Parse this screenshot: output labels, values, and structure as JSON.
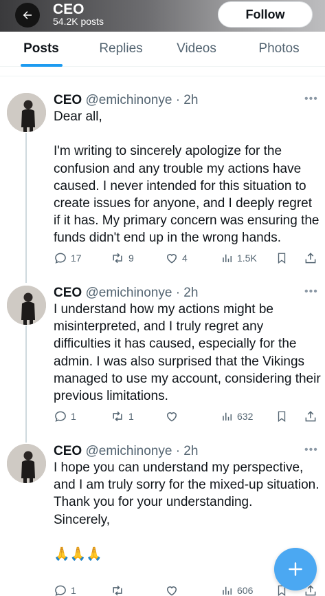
{
  "header": {
    "title": "CEO",
    "subtitle": "54.2K posts",
    "follow_label": "Follow"
  },
  "tabs": [
    {
      "label": "Posts",
      "active": true
    },
    {
      "label": "Replies",
      "active": false
    },
    {
      "label": "Videos",
      "active": false
    },
    {
      "label": "Photos",
      "active": false
    }
  ],
  "tweets": [
    {
      "name": "CEO",
      "meta": "@emichinonye · 2h",
      "text": "Dear all,\n\nI'm writing to sincerely apologize for the confusion and any trouble my actions have caused. I never intended for this situation to create issues for anyone, and I deeply regret if it has. My primary concern was ensuring the funds didn't end up in the wrong hands.",
      "replies": "17",
      "reposts": "9",
      "likes": "4",
      "views": "1.5K"
    },
    {
      "name": "CEO",
      "meta": "@emichinonye · 2h",
      "text": "I understand how my actions might be misinterpreted, and I truly regret any difficulties it has caused, especially for the admin. I was also surprised that the Vikings managed to use my account, considering their previous limitations.",
      "replies": "1",
      "reposts": "1",
      "likes": "",
      "views": "632"
    },
    {
      "name": "CEO",
      "meta": "@emichinonye · 2h",
      "text": "I hope you can understand my perspective, and I am truly sorry for the mixed-up situation. Thank you for your understanding.\nSincerely,\n\n🙏🙏🙏",
      "replies": "1",
      "reposts": "",
      "likes": "",
      "views": "606"
    }
  ],
  "colors": {
    "accent": "#1d9bf0",
    "fab": "#4ba8f2",
    "muted_text": "#536471"
  },
  "icons": [
    "back-arrow-icon",
    "more-icon",
    "reply-icon",
    "repost-icon",
    "like-icon",
    "views-icon",
    "bookmark-icon",
    "share-icon",
    "compose-icon"
  ]
}
